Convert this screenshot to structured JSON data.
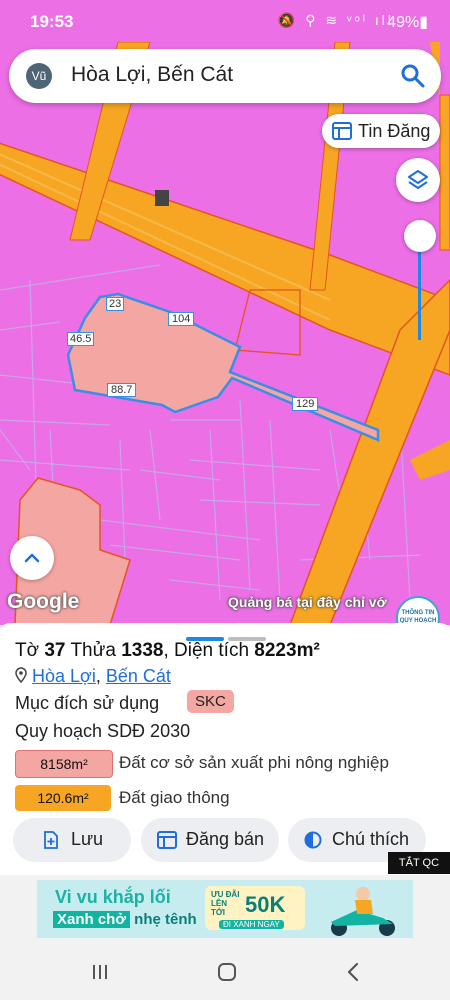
{
  "status_bar": {
    "time": "19:53",
    "icons_text": "🔕 ⚲ ≋ ᵛᵒˡ ıll",
    "battery": "49%▮"
  },
  "search": {
    "avatar_initials": "Vũ",
    "query": "Hòa Lợi, Bến Cát"
  },
  "map": {
    "tin_dang_label": "Tin Đăng",
    "google_label": "Google",
    "ad_text": "Quảng bá tại đây chỉ vớ",
    "thong_tin_label": "THÔNG TIN QUY HOẠCH",
    "edge_labels": [
      "23",
      "104",
      "46.5",
      "88.7",
      "129",
      "129"
    ],
    "colors": {
      "residential": "#ec6fe6",
      "road": "#f6a623",
      "parcel": "#f4a6a3",
      "outline": "#3a8ee6"
    }
  },
  "parcel": {
    "to_label": "Tờ",
    "to_value": "37",
    "thua_label": "Thửa",
    "thua_value": "1338",
    "area_label": "Diện tích",
    "area_value": "8223m²",
    "ward": "Hòa Lợi",
    "separator": ", ",
    "district": "Bến Cát",
    "purpose_label": "Mục đích sử dụng",
    "purpose_code": "SKC",
    "plan_label": "Quy hoạch SDĐ 2030",
    "plan_rows": [
      {
        "amount": "8158m²",
        "description": "Đất cơ sở sản xuất phi nông nghiệp",
        "color": "#f4a6a3"
      },
      {
        "amount": "120.6m²",
        "description": "Đất giao thông",
        "color": "#f6a623"
      }
    ]
  },
  "actions": {
    "save": "Lưu",
    "post_sale": "Đăng bán",
    "legend": "Chú thích"
  },
  "ad": {
    "close_label": "TẮT QC",
    "line1": "Vi vu khắp lối",
    "line2_highlight": "Xanh chở",
    "line2_rest": " nhẹ tênh",
    "promo_small": "ƯU ĐÃI LÊN TỚI",
    "promo_big": "50K",
    "promo_cta": "ĐI XANH NGAY"
  },
  "nav": {
    "recents": "|||",
    "home": "○",
    "back": "‹"
  }
}
